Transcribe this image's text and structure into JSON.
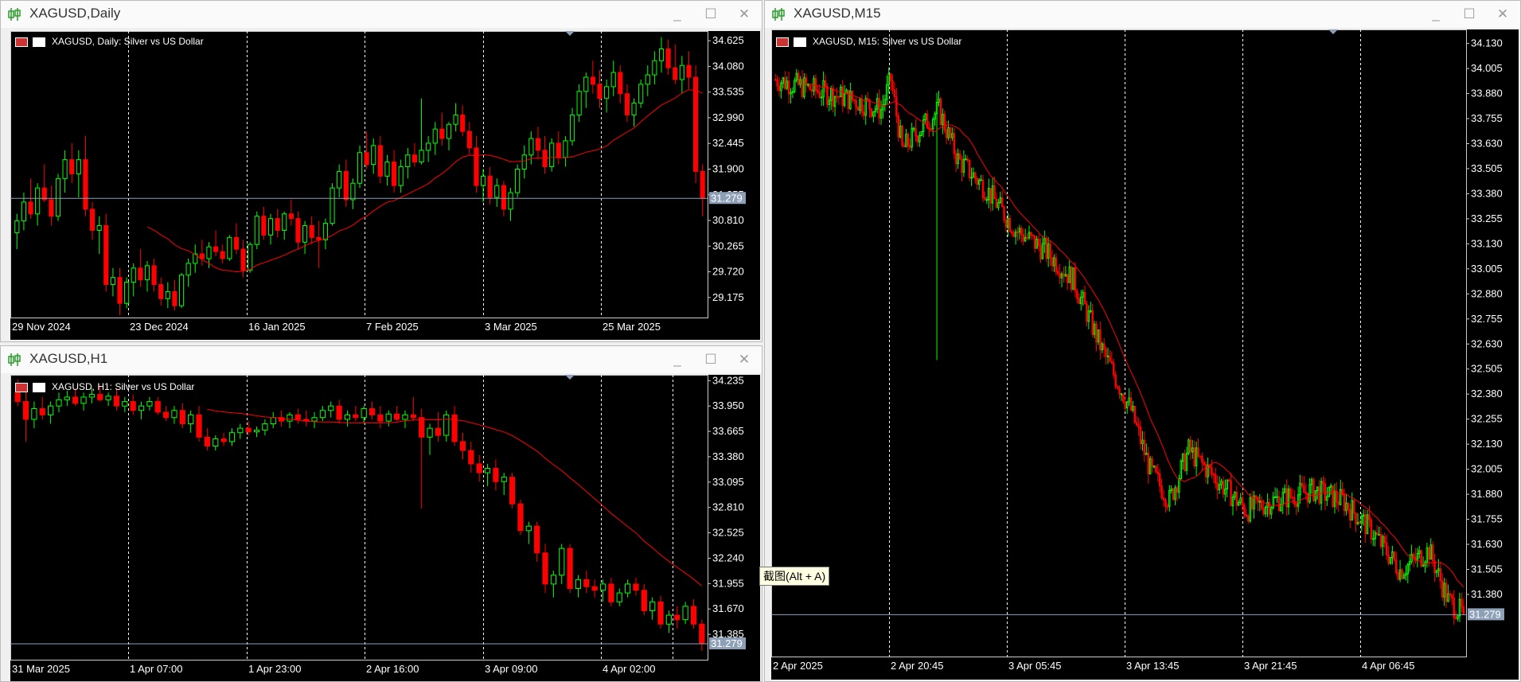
{
  "colors": {
    "up": "#00ff00",
    "down": "#ff0000",
    "ma": "#ff0000",
    "grid": "#ffffff",
    "bg": "#000000",
    "price_line": "#8ea0b8"
  },
  "windows": {
    "daily": {
      "title": "XAGUSD,Daily",
      "label": "XAGUSD, Daily:  Silver vs US Dollar",
      "controls": [
        "_",
        "☐",
        "✕"
      ]
    },
    "h1": {
      "title": "XAGUSD,H1",
      "label": "XAGUSD, H1:  Silver vs US Dollar",
      "controls": [
        "_",
        "☐",
        "✕"
      ]
    },
    "m15": {
      "title": "XAGUSD,M15",
      "label": "XAGUSD, M15:  Silver vs US Dollar",
      "controls": [
        "_",
        "☐",
        "✕"
      ]
    }
  },
  "tooltip": "截图(Alt + A)",
  "chart_data": [
    {
      "id": "daily",
      "type": "candlestick",
      "title": "XAGUSD, Daily:  Silver vs US Dollar",
      "y_ticks": [
        "34.625",
        "34.080",
        "33.535",
        "32.990",
        "32.445",
        "31.900",
        "31.355",
        "30.810",
        "30.265",
        "29.720",
        "29.175"
      ],
      "ylim": [
        28.75,
        34.83
      ],
      "x_ticks": [
        "29 Nov 2024",
        "23 Dec 2024",
        "16 Jan 2025",
        "7 Feb 2025",
        "3 Mar 2025",
        "25 Mar 2025"
      ],
      "current_price": "31.279",
      "ma_period_note": "",
      "candles": [
        [
          30.55,
          30.95,
          30.2,
          30.8
        ],
        [
          30.8,
          31.4,
          30.6,
          31.2
        ],
        [
          31.2,
          31.7,
          30.85,
          30.95
        ],
        [
          30.95,
          31.6,
          30.7,
          31.5
        ],
        [
          31.5,
          32.0,
          31.2,
          31.25
        ],
        [
          31.25,
          31.55,
          30.7,
          30.9
        ],
        [
          30.9,
          31.8,
          30.8,
          31.7
        ],
        [
          31.7,
          32.3,
          31.4,
          32.1
        ],
        [
          32.1,
          32.45,
          31.6,
          31.8
        ],
        [
          31.8,
          32.3,
          31.3,
          32.1
        ],
        [
          32.1,
          32.6,
          30.9,
          31.05
        ],
        [
          31.05,
          31.2,
          30.4,
          30.6
        ],
        [
          30.6,
          30.9,
          30.1,
          30.7
        ],
        [
          30.7,
          30.95,
          29.3,
          29.45
        ],
        [
          29.45,
          29.8,
          29.2,
          29.6
        ],
        [
          29.6,
          29.8,
          28.8,
          29.05
        ],
        [
          29.05,
          29.6,
          28.95,
          29.5
        ],
        [
          29.5,
          29.9,
          29.2,
          29.8
        ],
        [
          29.8,
          30.2,
          29.4,
          29.55
        ],
        [
          29.55,
          29.95,
          29.3,
          29.85
        ],
        [
          29.85,
          30.0,
          29.3,
          29.45
        ],
        [
          29.45,
          29.6,
          29.0,
          29.15
        ],
        [
          29.15,
          29.5,
          28.95,
          29.3
        ],
        [
          29.3,
          29.55,
          28.9,
          29.0
        ],
        [
          29.0,
          29.7,
          28.95,
          29.65
        ],
        [
          29.65,
          30.0,
          29.4,
          29.9
        ],
        [
          29.9,
          30.3,
          29.7,
          30.1
        ],
        [
          30.1,
          30.4,
          29.85,
          30.0
        ],
        [
          30.0,
          30.35,
          29.8,
          30.25
        ],
        [
          30.25,
          30.6,
          30.05,
          30.15
        ],
        [
          30.15,
          30.3,
          29.9,
          30.0
        ],
        [
          30.0,
          30.5,
          29.95,
          30.45
        ],
        [
          30.45,
          30.75,
          30.1,
          30.2
        ],
        [
          30.2,
          30.4,
          29.6,
          29.75
        ],
        [
          29.75,
          30.35,
          29.7,
          30.3
        ],
        [
          30.3,
          31.0,
          30.2,
          30.9
        ],
        [
          30.9,
          31.1,
          30.4,
          30.5
        ],
        [
          30.5,
          30.95,
          30.3,
          30.85
        ],
        [
          30.85,
          31.05,
          30.45,
          30.6
        ],
        [
          30.6,
          31.0,
          30.4,
          30.95
        ],
        [
          30.95,
          31.25,
          30.7,
          30.85
        ],
        [
          30.85,
          31.0,
          30.2,
          30.35
        ],
        [
          30.35,
          30.8,
          30.1,
          30.7
        ],
        [
          30.7,
          30.9,
          30.3,
          30.45
        ],
        [
          30.45,
          30.8,
          29.8,
          30.4
        ],
        [
          30.4,
          30.85,
          30.2,
          30.75
        ],
        [
          30.75,
          31.6,
          30.7,
          31.5
        ],
        [
          31.5,
          32.0,
          31.3,
          31.85
        ],
        [
          31.85,
          32.1,
          31.1,
          31.25
        ],
        [
          31.25,
          31.7,
          31.05,
          31.6
        ],
        [
          31.6,
          32.4,
          31.5,
          32.25
        ],
        [
          32.25,
          32.7,
          31.9,
          32.0
        ],
        [
          32.0,
          32.55,
          31.8,
          32.4
        ],
        [
          32.4,
          32.6,
          31.6,
          31.75
        ],
        [
          31.75,
          32.2,
          31.55,
          32.05
        ],
        [
          32.05,
          32.3,
          31.4,
          31.55
        ],
        [
          31.55,
          32.1,
          31.4,
          31.95
        ],
        [
          31.95,
          32.35,
          31.7,
          32.2
        ],
        [
          32.2,
          32.45,
          31.95,
          32.05
        ],
        [
          32.05,
          33.4,
          32.0,
          32.3
        ],
        [
          32.3,
          32.6,
          32.05,
          32.45
        ],
        [
          32.45,
          32.9,
          32.2,
          32.75
        ],
        [
          32.75,
          33.1,
          32.4,
          32.55
        ],
        [
          32.55,
          32.9,
          32.3,
          32.85
        ],
        [
          32.85,
          33.3,
          32.7,
          33.05
        ],
        [
          33.05,
          33.25,
          32.6,
          32.7
        ],
        [
          32.7,
          32.9,
          32.2,
          32.35
        ],
        [
          32.35,
          32.6,
          31.4,
          31.55
        ],
        [
          31.55,
          31.9,
          31.2,
          31.75
        ],
        [
          31.75,
          31.95,
          31.15,
          31.3
        ],
        [
          31.3,
          31.7,
          31.1,
          31.55
        ],
        [
          31.55,
          31.65,
          30.9,
          31.05
        ],
        [
          31.05,
          31.5,
          30.8,
          31.4
        ],
        [
          31.4,
          32.0,
          31.3,
          31.9
        ],
        [
          31.9,
          32.4,
          31.7,
          32.2
        ],
        [
          32.2,
          32.7,
          32.0,
          32.55
        ],
        [
          32.55,
          32.8,
          32.1,
          32.3
        ],
        [
          32.3,
          32.6,
          31.8,
          31.95
        ],
        [
          31.95,
          32.55,
          31.85,
          32.45
        ],
        [
          32.45,
          32.7,
          32.0,
          32.15
        ],
        [
          32.15,
          32.6,
          31.95,
          32.5
        ],
        [
          32.5,
          33.2,
          32.4,
          33.05
        ],
        [
          33.05,
          33.7,
          32.9,
          33.55
        ],
        [
          33.55,
          33.95,
          33.2,
          33.85
        ],
        [
          33.85,
          34.2,
          33.5,
          33.7
        ],
        [
          33.7,
          34.0,
          33.2,
          33.4
        ],
        [
          33.4,
          33.8,
          33.1,
          33.65
        ],
        [
          33.65,
          34.2,
          33.45,
          33.95
        ],
        [
          33.95,
          34.1,
          33.3,
          33.5
        ],
        [
          33.5,
          33.7,
          32.9,
          33.05
        ],
        [
          33.05,
          33.4,
          32.8,
          33.3
        ],
        [
          33.3,
          33.8,
          33.2,
          33.7
        ],
        [
          33.7,
          34.1,
          33.45,
          33.9
        ],
        [
          33.9,
          34.4,
          33.7,
          34.2
        ],
        [
          34.2,
          34.7,
          33.95,
          34.45
        ],
        [
          34.45,
          34.65,
          33.9,
          34.05
        ],
        [
          34.05,
          34.55,
          33.7,
          33.8
        ],
        [
          33.8,
          34.3,
          33.5,
          34.1
        ],
        [
          34.1,
          34.4,
          33.6,
          33.85
        ],
        [
          33.85,
          34.1,
          31.6,
          31.85
        ],
        [
          31.85,
          32.0,
          30.9,
          31.28
        ]
      ]
    },
    {
      "id": "h1",
      "type": "candlestick",
      "title": "XAGUSD, H1:  Silver vs US Dollar",
      "y_ticks": [
        "34.235",
        "33.950",
        "33.665",
        "33.380",
        "33.095",
        "32.810",
        "32.525",
        "32.240",
        "31.955",
        "31.670",
        "31.385"
      ],
      "ylim": [
        31.1,
        34.3
      ],
      "x_ticks": [
        "31 Mar 2025",
        "1 Apr 07:00",
        "1 Apr 23:00",
        "2 Apr 16:00",
        "3 Apr 09:00",
        "4 Apr 02:00"
      ],
      "current_price": "31.279",
      "candles": [
        [
          34.1,
          34.25,
          33.95,
          34.0
        ],
        [
          34.0,
          34.15,
          33.55,
          33.8
        ],
        [
          33.8,
          34.0,
          33.7,
          33.92
        ],
        [
          33.92,
          34.05,
          33.8,
          33.85
        ],
        [
          33.85,
          34.0,
          33.75,
          33.95
        ],
        [
          33.95,
          34.1,
          33.88,
          34.02
        ],
        [
          34.02,
          34.12,
          33.95,
          34.05
        ],
        [
          34.05,
          34.15,
          33.95,
          33.98
        ],
        [
          33.98,
          34.1,
          33.9,
          34.05
        ],
        [
          34.05,
          34.15,
          33.98,
          34.08
        ],
        [
          34.08,
          34.18,
          34.0,
          34.02
        ],
        [
          34.02,
          34.1,
          33.95,
          34.06
        ],
        [
          34.06,
          34.15,
          33.9,
          33.95
        ],
        [
          33.95,
          34.05,
          33.88,
          34.0
        ],
        [
          34.0,
          34.08,
          33.85,
          33.9
        ],
        [
          33.9,
          34.0,
          33.8,
          33.95
        ],
        [
          33.95,
          34.05,
          33.9,
          34.0
        ],
        [
          34.0,
          34.05,
          33.85,
          33.88
        ],
        [
          33.88,
          33.95,
          33.78,
          33.82
        ],
        [
          33.82,
          33.95,
          33.75,
          33.9
        ],
        [
          33.9,
          33.98,
          33.7,
          33.75
        ],
        [
          33.75,
          33.9,
          33.65,
          33.85
        ],
        [
          33.85,
          33.95,
          33.55,
          33.6
        ],
        [
          33.6,
          33.7,
          33.45,
          33.5
        ],
        [
          33.5,
          33.62,
          33.45,
          33.58
        ],
        [
          33.58,
          33.65,
          33.5,
          33.55
        ],
        [
          33.55,
          33.7,
          33.5,
          33.65
        ],
        [
          33.65,
          33.75,
          33.58,
          33.7
        ],
        [
          33.7,
          33.78,
          33.62,
          33.66
        ],
        [
          33.66,
          33.72,
          33.6,
          33.68
        ],
        [
          33.68,
          33.8,
          33.62,
          33.75
        ],
        [
          33.75,
          33.88,
          33.7,
          33.82
        ],
        [
          33.82,
          33.9,
          33.72,
          33.78
        ],
        [
          33.78,
          33.88,
          33.7,
          33.85
        ],
        [
          33.85,
          33.92,
          33.75,
          33.8
        ],
        [
          33.8,
          33.9,
          33.72,
          33.78
        ],
        [
          33.78,
          33.88,
          33.7,
          33.82
        ],
        [
          33.82,
          33.95,
          33.78,
          33.9
        ],
        [
          33.9,
          34.0,
          33.82,
          33.95
        ],
        [
          33.95,
          34.02,
          33.75,
          33.8
        ],
        [
          33.8,
          33.9,
          33.72,
          33.85
        ],
        [
          33.85,
          33.95,
          33.78,
          33.82
        ],
        [
          33.82,
          33.95,
          33.75,
          33.92
        ],
        [
          33.92,
          34.0,
          33.8,
          33.85
        ],
        [
          33.85,
          33.95,
          33.7,
          33.78
        ],
        [
          33.78,
          33.9,
          33.72,
          33.86
        ],
        [
          33.86,
          33.95,
          33.78,
          33.8
        ],
        [
          33.8,
          33.9,
          33.7,
          33.85
        ],
        [
          33.85,
          34.05,
          33.78,
          33.82
        ],
        [
          33.82,
          33.92,
          32.8,
          33.6
        ],
        [
          33.6,
          33.75,
          33.4,
          33.7
        ],
        [
          33.7,
          33.88,
          33.55,
          33.62
        ],
        [
          33.62,
          33.9,
          33.55,
          33.85
        ],
        [
          33.85,
          33.95,
          33.5,
          33.55
        ],
        [
          33.55,
          33.65,
          33.35,
          33.45
        ],
        [
          33.45,
          33.55,
          33.2,
          33.3
        ],
        [
          33.3,
          33.4,
          33.1,
          33.2
        ],
        [
          33.2,
          33.3,
          33.05,
          33.25
        ],
        [
          33.25,
          33.35,
          33.0,
          33.1
        ],
        [
          33.1,
          33.2,
          32.95,
          33.15
        ],
        [
          33.15,
          33.2,
          32.8,
          32.85
        ],
        [
          32.85,
          32.9,
          32.5,
          32.55
        ],
        [
          32.55,
          32.65,
          32.4,
          32.6
        ],
        [
          32.6,
          32.65,
          32.2,
          32.3
        ],
        [
          32.3,
          32.4,
          31.85,
          31.95
        ],
        [
          31.95,
          32.1,
          31.8,
          32.05
        ],
        [
          32.05,
          32.4,
          31.95,
          32.35
        ],
        [
          32.35,
          32.4,
          31.85,
          31.9
        ],
        [
          31.9,
          32.05,
          31.8,
          32.0
        ],
        [
          32.0,
          32.1,
          31.85,
          31.92
        ],
        [
          31.92,
          32.0,
          31.8,
          31.88
        ],
        [
          31.88,
          32.0,
          31.75,
          31.95
        ],
        [
          31.95,
          32.02,
          31.7,
          31.75
        ],
        [
          31.75,
          31.9,
          31.7,
          31.85
        ],
        [
          31.85,
          32.0,
          31.8,
          31.95
        ],
        [
          31.95,
          32.02,
          31.82,
          31.88
        ],
        [
          31.88,
          31.95,
          31.6,
          31.65
        ],
        [
          31.65,
          31.8,
          31.55,
          31.75
        ],
        [
          31.75,
          31.82,
          31.45,
          31.5
        ],
        [
          31.5,
          31.65,
          31.4,
          31.6
        ],
        [
          31.6,
          31.7,
          31.45,
          31.55
        ],
        [
          31.55,
          31.75,
          31.5,
          31.7
        ],
        [
          31.7,
          31.78,
          31.45,
          31.5
        ],
        [
          31.5,
          31.55,
          31.2,
          31.28
        ]
      ]
    },
    {
      "id": "m15",
      "type": "candlestick",
      "title": "XAGUSD, M15:  Silver vs US Dollar",
      "y_ticks": [
        "34.130",
        "34.005",
        "33.880",
        "33.755",
        "33.630",
        "33.505",
        "33.380",
        "33.255",
        "33.130",
        "33.005",
        "32.880",
        "32.755",
        "32.630",
        "32.505",
        "32.380",
        "32.255",
        "32.130",
        "32.005",
        "31.880",
        "31.755",
        "31.630",
        "31.505",
        "31.380",
        "31.279"
      ],
      "ylim": [
        31.07,
        34.2
      ],
      "x_ticks": [
        "2 Apr 2025",
        "2 Apr 20:45",
        "3 Apr 05:45",
        "3 Apr 13:45",
        "3 Apr 21:45",
        "4 Apr 06:45"
      ],
      "current_price": "31.279"
    }
  ]
}
